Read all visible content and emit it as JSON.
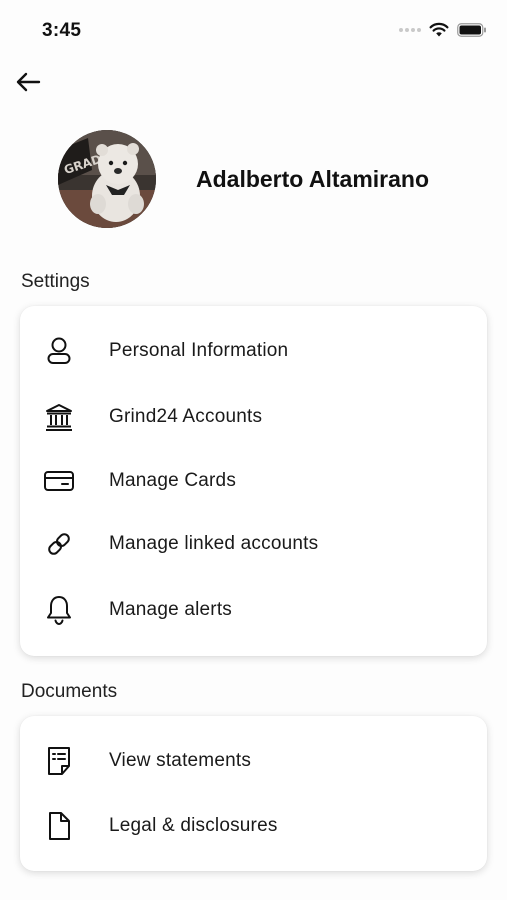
{
  "status_bar": {
    "time": "3:45",
    "icons": [
      "signal-icon",
      "wifi-icon",
      "battery-icon"
    ]
  },
  "header": {
    "back_icon": "arrow-left-icon"
  },
  "profile": {
    "name": "Adalberto Altamirano",
    "avatar": "avatar-image"
  },
  "settings": {
    "title": "Settings",
    "items": [
      {
        "label": "Personal Information",
        "icon": "person-icon"
      },
      {
        "label": "Grind24 Accounts",
        "icon": "bank-icon"
      },
      {
        "label": "Manage Cards",
        "icon": "card-icon"
      },
      {
        "label": "Manage linked accounts",
        "icon": "link-icon"
      },
      {
        "label": "Manage alerts",
        "icon": "bell-icon"
      }
    ]
  },
  "documents": {
    "title": "Documents",
    "items": [
      {
        "label": "View statements",
        "icon": "statement-icon"
      },
      {
        "label": "Legal & disclosures",
        "icon": "document-icon"
      }
    ]
  }
}
